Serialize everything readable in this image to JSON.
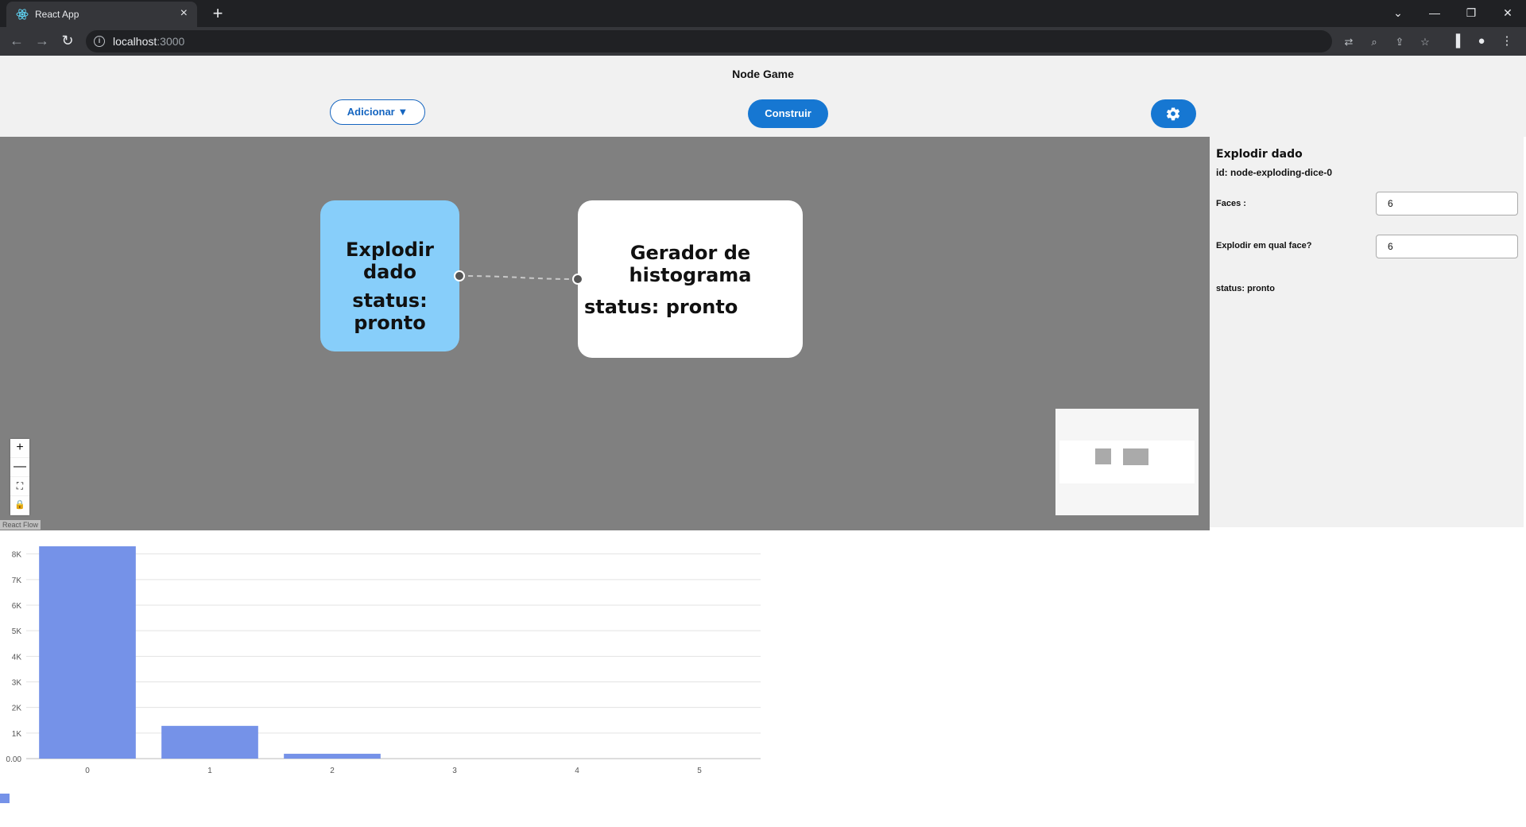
{
  "browser": {
    "tab_title": "React App",
    "tab_close": "×",
    "new_tab": "+",
    "url_host": "localhost",
    "url_port": ":3000",
    "icons": [
      "react-favicon",
      "back-arrow",
      "forward-arrow",
      "reload",
      "translate",
      "zoom",
      "share",
      "star",
      "side-panel",
      "profile",
      "menu"
    ]
  },
  "app": {
    "title": "Node Game",
    "add_label": "Adicionar ▼",
    "build_label": "Construir",
    "settings_icon": "gear-icon",
    "accent": "#1677d2"
  },
  "flow": {
    "nodes": [
      {
        "name": "Explodir dado",
        "status": "status: pronto",
        "color": "#87cefa"
      },
      {
        "name": "Gerador de histograma",
        "status": "status: pronto",
        "color": "#ffffff"
      }
    ],
    "canvas_color": "#808080",
    "controls": [
      "+",
      "—",
      "⛶",
      "🔒"
    ],
    "attribution": "React Flow"
  },
  "panel": {
    "title": "Explodir dado",
    "id": "id: node-exploding-dice-0",
    "faces_label": "Faces :",
    "faces_value": "6",
    "explode_label": "Explodir em qual face?",
    "explode_value": "6",
    "status": "status: pronto"
  },
  "chart_data": {
    "type": "bar",
    "categories": [
      "0",
      "1",
      "2",
      "3",
      "4",
      "5"
    ],
    "values": [
      8300,
      1280,
      190,
      0,
      0,
      0
    ],
    "ylim": [
      0,
      8300
    ],
    "yticks": [
      0,
      1000,
      2000,
      3000,
      4000,
      5000,
      6000,
      7000,
      8000
    ],
    "ytick_labels": [
      "0.00",
      "1K",
      "2K",
      "3K",
      "4K",
      "5K",
      "6K",
      "7K",
      "8K"
    ],
    "bar_color": "#7592e8",
    "grid": true,
    "legend": "bottom-left"
  }
}
